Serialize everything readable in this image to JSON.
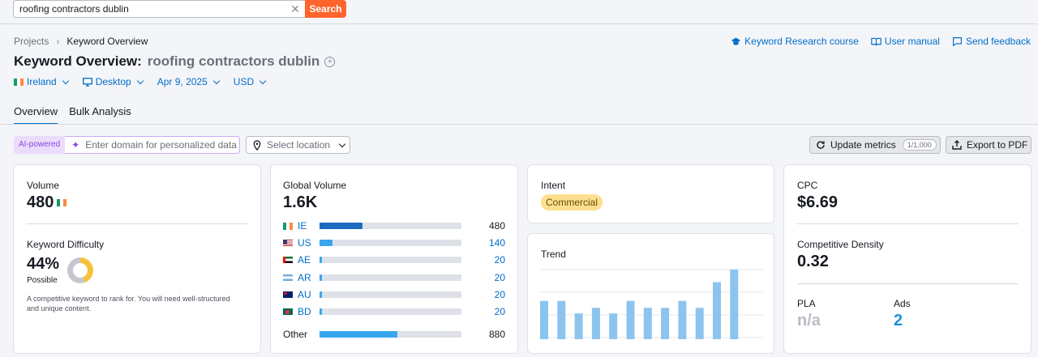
{
  "search": {
    "value": "roofing contractors dublin",
    "button": "Search",
    "clear_icon": "close-icon"
  },
  "breadcrumb": {
    "parent": "Projects",
    "current": "Keyword Overview"
  },
  "header_links": [
    {
      "label": "Keyword Research course",
      "icon": "graduation-cap-icon"
    },
    {
      "label": "User manual",
      "icon": "book-icon"
    },
    {
      "label": "Send feedback",
      "icon": "chat-icon"
    }
  ],
  "title": {
    "prefix": "Keyword Overview:",
    "keyword": "roofing contractors dublin"
  },
  "filters": {
    "country": "Ireland",
    "device": "Desktop",
    "date": "Apr 9, 2025",
    "currency": "USD"
  },
  "tabs": [
    "Overview",
    "Bulk Analysis"
  ],
  "toolbar": {
    "ai_badge": "AI-powered",
    "domain_placeholder": "Enter domain for personalized data",
    "location_placeholder": "Select location",
    "update_label": "Update metrics",
    "update_count": "1/1,000",
    "export_label": "Export to PDF"
  },
  "volume": {
    "label": "Volume",
    "value": "480"
  },
  "difficulty": {
    "label": "Keyword Difficulty",
    "value": "44%",
    "percent": 44,
    "level": "Possible",
    "description": "A competitive keyword to rank for. You will need well-structured and unique content.",
    "ring_color": "#f7c13b"
  },
  "global_volume": {
    "label": "Global Volume",
    "value": "1.6K",
    "rows": [
      {
        "code": "IE",
        "value": "480",
        "share": 0.3,
        "color": "#1d6ac2"
      },
      {
        "code": "US",
        "value": "140",
        "share": 0.09,
        "color": "#38a6ed"
      },
      {
        "code": "AE",
        "value": "20",
        "share": 0.015,
        "color": "#38a6ed"
      },
      {
        "code": "AR",
        "value": "20",
        "share": 0.015,
        "color": "#38a6ed"
      },
      {
        "code": "AU",
        "value": "20",
        "share": 0.015,
        "color": "#38a6ed"
      },
      {
        "code": "BD",
        "value": "20",
        "share": 0.015,
        "color": "#38a6ed"
      }
    ],
    "other": {
      "code": "Other",
      "value": "880",
      "share": 0.55,
      "color": "#38a6ed"
    }
  },
  "intent": {
    "label": "Intent",
    "value": "Commercial",
    "color": "#fcdf8f"
  },
  "trend": {
    "label": "Trend",
    "values": [
      0.55,
      0.55,
      0.37,
      0.45,
      0.37,
      0.55,
      0.45,
      0.45,
      0.55,
      0.45,
      0.82,
      1.0
    ],
    "color": "#8dc4ee"
  },
  "cpc": {
    "label": "CPC",
    "value": "$6.69"
  },
  "density": {
    "label": "Competitive Density",
    "value": "0.32"
  },
  "pla": {
    "label": "PLA",
    "value": "n/a"
  },
  "ads": {
    "label": "Ads",
    "value": "2",
    "color": "#1d8fd6"
  }
}
